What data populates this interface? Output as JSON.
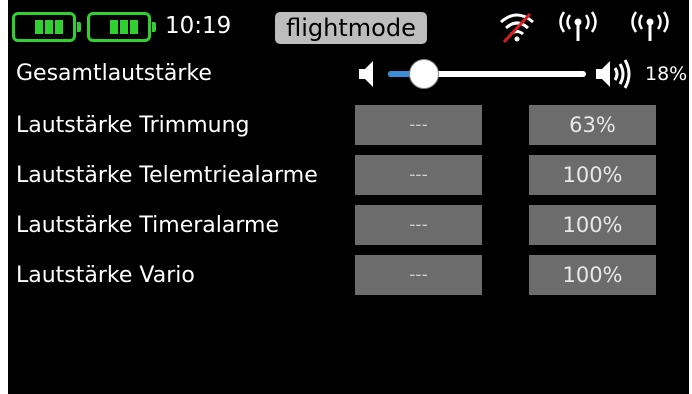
{
  "statusbar": {
    "battery_1_icon": "battery-full-icon",
    "battery_2_icon": "battery-full-icon",
    "time": "10:19",
    "flightmode": "flightmode",
    "signal_icons": [
      "wifi-off-icon",
      "antenna-icon",
      "antenna-icon"
    ]
  },
  "master_volume": {
    "label": "Gesamtlautstärke",
    "value_text": "18%",
    "level": 0.18
  },
  "rows": [
    {
      "label": "Lautstärke Trimmung",
      "left": "---",
      "right": "63%"
    },
    {
      "label": "Lautstärke Telemtriealarme",
      "left": "---",
      "right": "100%"
    },
    {
      "label": "Lautstärke Timeralarme",
      "left": "---",
      "right": "100%"
    },
    {
      "label": "Lautstärke Vario",
      "left": "---",
      "right": "100%"
    }
  ],
  "colors": {
    "accent": "#3c8bd8",
    "battery": "#2fd02f",
    "button": "#6c6c6c",
    "signal_off": "#d62020"
  }
}
